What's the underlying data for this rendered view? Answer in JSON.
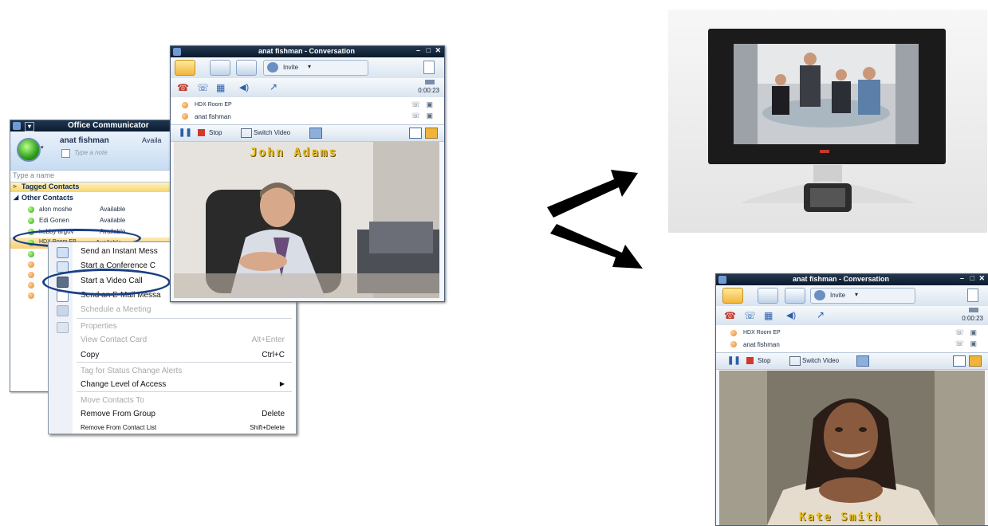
{
  "communicator": {
    "title": "Office Communicator",
    "user_name": "anat fishman",
    "user_status": "Availa",
    "note_placeholder": "Type a note",
    "search_placeholder": "Type a name",
    "group_tagged": "Tagged Contacts",
    "group_other": "Other Contacts",
    "contacts": [
      {
        "name": "alon moshe",
        "status": "Available"
      },
      {
        "name": "Edi Gonen",
        "status": "Available"
      },
      {
        "name": "kobby argov",
        "status": "Available"
      },
      {
        "name": "HDX Room EP",
        "status": "Available"
      }
    ]
  },
  "context_menu": {
    "items": [
      {
        "label": "Send an Instant Mess",
        "shortcut": "",
        "disabled": false
      },
      {
        "label": "Start a Conference C",
        "shortcut": "",
        "disabled": false
      },
      {
        "label": "Start a Video Call",
        "shortcut": "",
        "disabled": false
      },
      {
        "label": "Send an E-Mail Messa",
        "shortcut": "",
        "disabled": false
      },
      {
        "label": "Schedule a Meeting",
        "shortcut": "",
        "disabled": true
      },
      {
        "label": "Properties",
        "shortcut": "",
        "disabled": true
      },
      {
        "label": "View Contact Card",
        "shortcut": "Alt+Enter",
        "disabled": true
      },
      {
        "label": "Copy",
        "shortcut": "Ctrl+C",
        "disabled": false
      },
      {
        "label": "Tag for Status Change Alerts",
        "shortcut": "",
        "disabled": true
      },
      {
        "label": "Change Level of Access",
        "shortcut": "▶",
        "disabled": false
      },
      {
        "label": "Move Contacts To",
        "shortcut": "",
        "disabled": true
      },
      {
        "label": "Remove From Group",
        "shortcut": "Delete",
        "disabled": false
      },
      {
        "label": "Remove From Contact List",
        "shortcut": "Shift+Delete",
        "disabled": false
      }
    ]
  },
  "conversation_left": {
    "title": "anat fishman - Conversation",
    "invite_label": "Invite",
    "timer": "0:00:23",
    "participants": [
      "HDX Room EP",
      "anat fishman"
    ],
    "stop_label": "Stop",
    "switch_video_label": "Switch Video",
    "caller_label": "John Adams"
  },
  "conversation_right": {
    "title": "anat fishman - Conversation",
    "invite_label": "Invite",
    "timer": "0:00:23",
    "participants": [
      "HDX Room EP",
      "anat fishman"
    ],
    "stop_label": "Stop",
    "switch_video_label": "Switch Video",
    "caller_label": "Kate Smith"
  },
  "colors": {
    "accent_blue": "#1d3a6e",
    "highlight_oval": "#1a3f86",
    "presence_green": "#2da01c",
    "title_bar": "#0c1c30"
  }
}
